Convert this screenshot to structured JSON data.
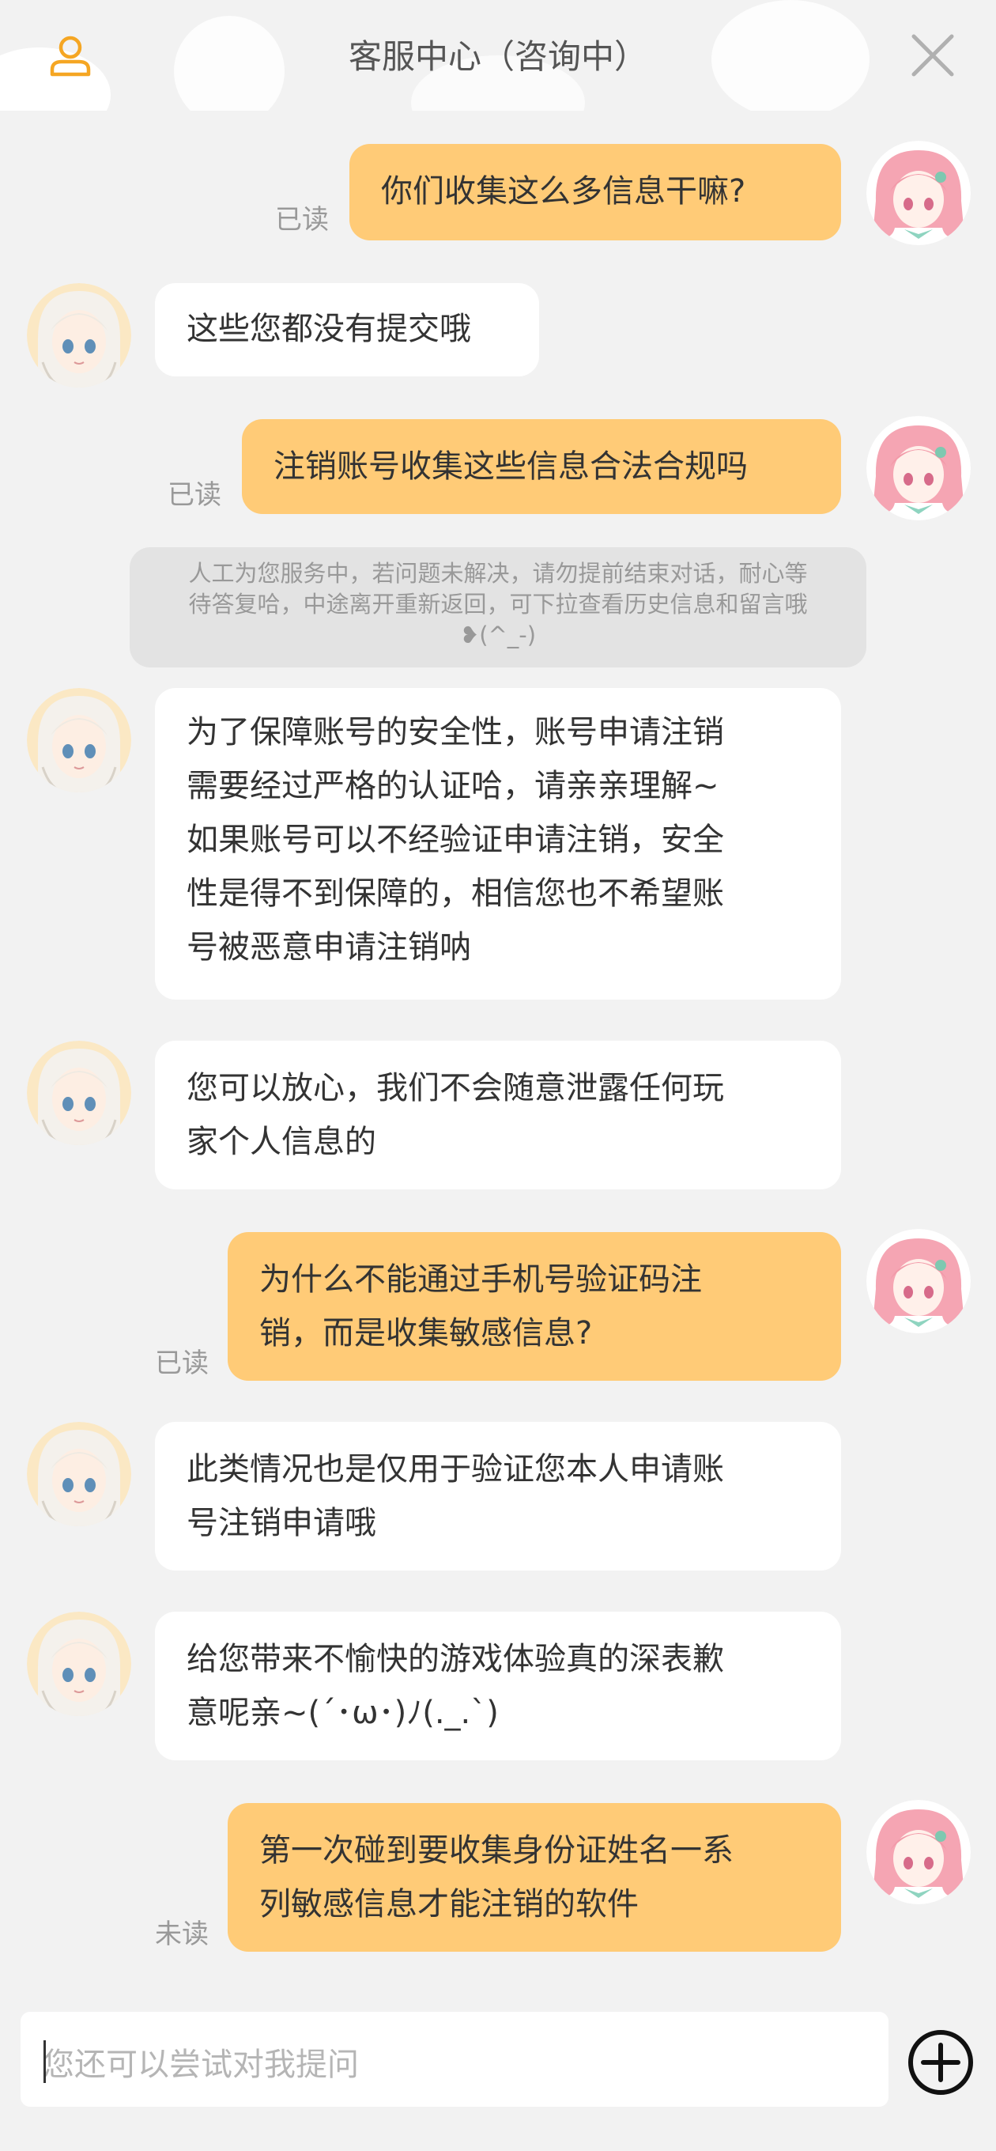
{
  "header": {
    "title": "客服中心（咨询中）",
    "user_icon": "user-icon",
    "close_icon": "close-icon"
  },
  "messages": [
    {
      "sender": "user",
      "text": "你们收集这么多信息干嘛?",
      "status": "已读"
    },
    {
      "sender": "agent",
      "text": "这些您都没有提交哦"
    },
    {
      "sender": "user",
      "text": "注销账号收集这些信息合法合规吗",
      "status": "已读"
    },
    {
      "sender": "agent",
      "lines": [
        "为了保障账号的安全性，账号申请注销",
        "需要经过严格的认证哈，请亲亲理解~",
        "如果账号可以不经验证申请注销，安全",
        "性是得不到保障的，相信您也不希望账",
        "号被恶意申请注销呐"
      ]
    },
    {
      "sender": "agent",
      "lines": [
        "您可以放心，我们不会随意泄露任何玩",
        "家个人信息的"
      ]
    },
    {
      "sender": "user",
      "lines": [
        "为什么不能通过手机号验证码注",
        "销，而是收集敏感信息?"
      ],
      "status": "已读"
    },
    {
      "sender": "agent",
      "lines": [
        "此类情况也是仅用于验证您本人申请账",
        "号注销申请哦"
      ]
    },
    {
      "sender": "agent",
      "lines": [
        "给您带来不愉快的游戏体验真的深表歉",
        "意呢亲~(´･ω･)ﾉ(._.`)"
      ]
    },
    {
      "sender": "user",
      "lines": [
        "第一次碰到要收集身份证姓名一系",
        "列敏感信息才能注销的软件"
      ],
      "status": "未读"
    }
  ],
  "system_note": {
    "lines": [
      "人工为您服务中，若问题未解决，请勿提前结束对话，耐心等",
      "待答复哈，中途离开重新返回，可下拉查看历史信息和留言哦",
      "❥(^_-)"
    ]
  },
  "input": {
    "placeholder": "您还可以尝试对我提问",
    "add_icon": "plus-circle-icon"
  },
  "colors": {
    "user_bubble": "#ffcb77",
    "agent_bubble": "#ffffff",
    "background": "#f2f2f2",
    "accent": "#f5a623"
  }
}
